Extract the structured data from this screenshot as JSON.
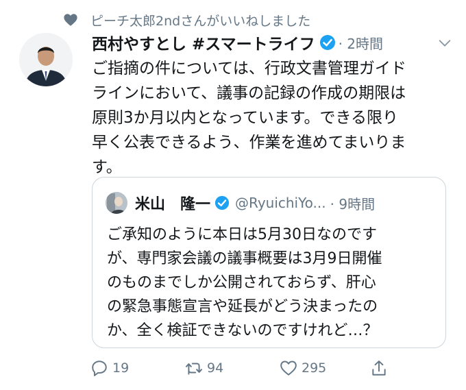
{
  "social_context": {
    "text": "ピーチ太郎2ndさんがいいねしました",
    "icon": "heart-icon"
  },
  "tweet": {
    "author_name": "西村やすとし #スマートライフ",
    "time": "· 2時間",
    "body_lines": [
      "ご指摘の件については、行政文書管理ガイド",
      "ラインにおいて、議事の記録の作成の期限は",
      "原則3か月以内となっています。できる限り",
      "早く公表できるよう、作業を進めてまいりま",
      "す。"
    ]
  },
  "quoted": {
    "author_name": "米山　隆一",
    "handle": "@RyuichiYo...",
    "time": "· 9時間",
    "body_lines": [
      "ご承知のように本日は5月30日なのです",
      "が、専門家会議の議事概要は3月9日開催",
      "のものまでしか公開されておらず、肝心",
      "の緊急事態宣言や延長がどう決まったの",
      "か、全く検証できないのですけれど…？"
    ]
  },
  "actions": {
    "reply_count": "19",
    "retweet_count": "94",
    "like_count": "295"
  },
  "colors": {
    "accent": "#1da1f2",
    "muted": "#657786",
    "text": "#14171a",
    "border": "#ccd6dd"
  }
}
